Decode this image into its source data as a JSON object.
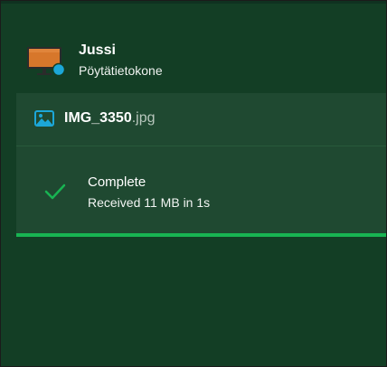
{
  "device": {
    "name": "Jussi",
    "type": "Pöytätietokone",
    "icon": "desktop-computer-icon"
  },
  "transfer": {
    "file": {
      "name": "IMG_3350",
      "extension": ".jpg",
      "icon": "image-file-icon"
    },
    "status": {
      "title": "Complete",
      "detail": "Received 11 MB in 1s",
      "icon": "check-icon",
      "progress": 1.0
    }
  },
  "colors": {
    "background": "#133e25",
    "card": "#1f4931",
    "accent": "#18b452",
    "image_icon": "#1ca7d8",
    "monitor": "#d7772b"
  }
}
